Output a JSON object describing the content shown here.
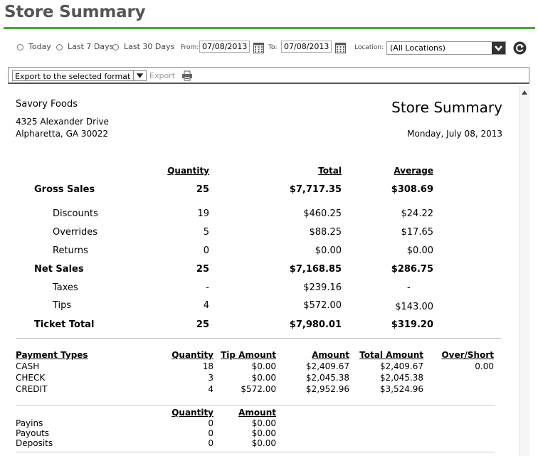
{
  "page": {
    "title": "Store Summary",
    "accent_color": "#44aa33"
  },
  "filters": {
    "today_label": "Today",
    "last7_label": "Last 7 Days",
    "last30_label": "Last 30 Days",
    "from_label": "From:",
    "from_value": "07/08/2013",
    "to_label": "To:",
    "to_value": "07/08/2013",
    "location_label": "Location:",
    "location_value": "(All Locations)"
  },
  "toolbar": {
    "export_format": "Export to the selected format",
    "export_label": "Export"
  },
  "report": {
    "company": "Savory Foods",
    "address1": "4325 Alexander Drive",
    "address2": "Alpharetta, GA 30022",
    "title": "Store Summary",
    "date": "Monday, July 08, 2013",
    "sales_headers": {
      "quantity": "Quantity",
      "total": "Total",
      "average": "Average"
    },
    "sales_rows": [
      {
        "label": "Gross Sales",
        "quantity": "25",
        "total": "$7,717.35",
        "average": "$308.69"
      },
      {
        "label": "Discounts",
        "quantity": "19",
        "total": "$460.25",
        "average": "$24.22"
      },
      {
        "label": "Overrides",
        "quantity": "5",
        "total": "$88.25",
        "average": "$17.65"
      },
      {
        "label": "Returns",
        "quantity": "0",
        "total": "$0.00",
        "average": "$0.00"
      },
      {
        "label": "Net Sales",
        "quantity": "25",
        "total": "$7,168.85",
        "average": "$286.75"
      },
      {
        "label": "Taxes",
        "quantity": "-",
        "total": "$239.16",
        "average": "-"
      },
      {
        "label": "Tips",
        "quantity": "4",
        "total": "$572.00",
        "average": "$143.00"
      },
      {
        "label": "Ticket Total",
        "quantity": "25",
        "total": "$7,980.01",
        "average": "$319.20"
      }
    ],
    "payment_headers": {
      "type": "Payment Types",
      "quantity": "Quantity",
      "tip": "Tip Amount",
      "amount": "Amount",
      "total": "Total Amount",
      "over_short": "Over/Short"
    },
    "payment_rows": [
      {
        "type": "CASH",
        "quantity": "18",
        "tip": "$0.00",
        "amount": "$2,409.67",
        "total": "$2,409.67",
        "over_short": "0.00"
      },
      {
        "type": "CHECK",
        "quantity": "3",
        "tip": "$0.00",
        "amount": "$2,045.38",
        "total": "$2,045.38",
        "over_short": ""
      },
      {
        "type": "CREDIT",
        "quantity": "4",
        "tip": "$572.00",
        "amount": "$2,952.96",
        "total": "$3,524.96",
        "over_short": ""
      }
    ],
    "cash_headers": {
      "quantity": "Quantity",
      "amount": "Amount"
    },
    "cash_rows": [
      {
        "label": "Payins",
        "quantity": "0",
        "amount": "$0.00"
      },
      {
        "label": "Payouts",
        "quantity": "0",
        "amount": "$0.00"
      },
      {
        "label": "Deposits",
        "quantity": "0",
        "amount": "$0.00"
      }
    ]
  }
}
